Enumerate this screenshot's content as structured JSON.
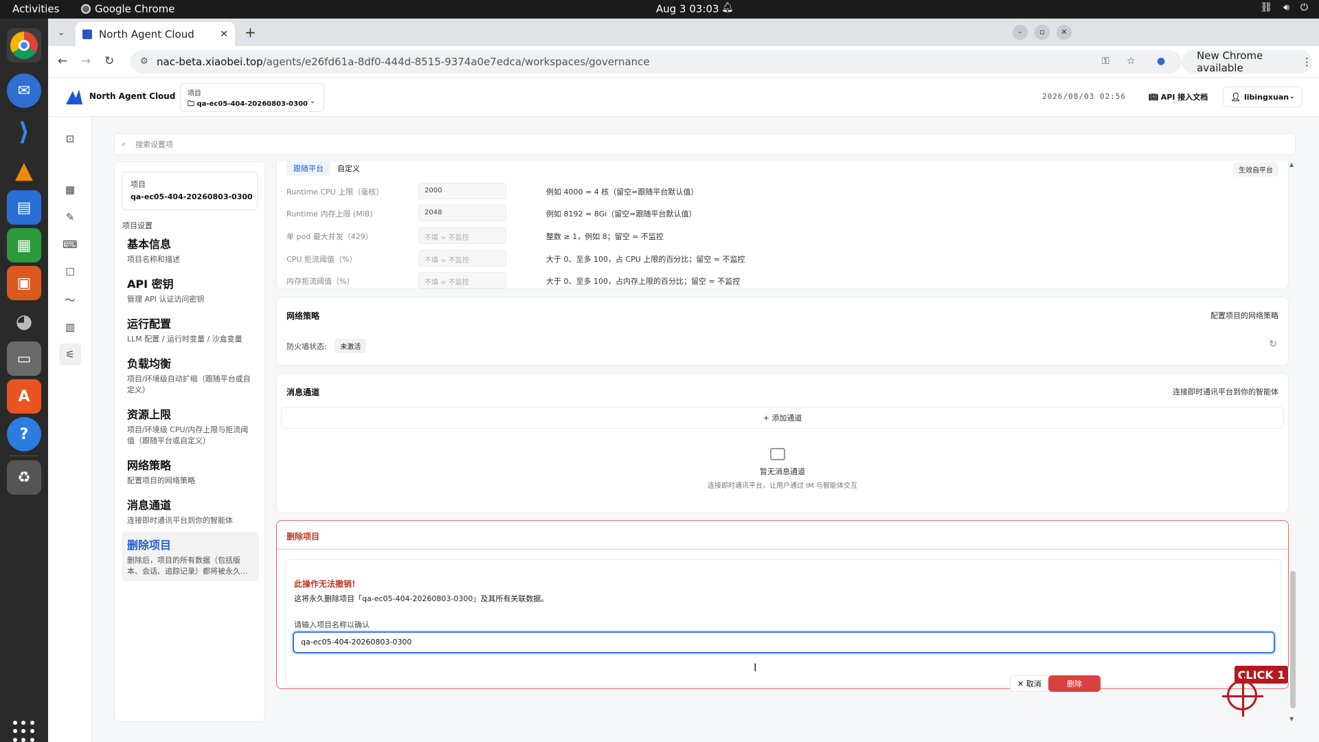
{
  "system": {
    "activities": "Activities",
    "app_name": "Google Chrome",
    "clock": "Aug 3  03:03"
  },
  "browser": {
    "tab_title": "North Agent Cloud",
    "url_host": "nac-beta.xiaobei.top",
    "url_path": "/agents/e26fd61a-8df0-444d-8515-9374a0e7edca/workspaces/governance",
    "new_chrome": "New Chrome available"
  },
  "header": {
    "brand": "North Agent Cloud",
    "project_label": "项目",
    "project_value": "qa-ec05-404-20260803-0300",
    "timestamp": "2026/08/03 02:56",
    "api_docs": "API 接入文档",
    "user": "libingxuan"
  },
  "search": {
    "placeholder": "搜索设置项"
  },
  "settings_nav": {
    "project_label": "项目",
    "project_value": "qa-ec05-404-20260803-0300",
    "heading": "项目设置",
    "items": [
      {
        "title": "基本信息",
        "desc": "项目名称和描述"
      },
      {
        "title": "API 密钥",
        "desc": "管理 API 认证访问密钥"
      },
      {
        "title": "运行配置",
        "desc": "LLM 配置 / 运行时变量 / 沙盒变量"
      },
      {
        "title": "负载均衡",
        "desc": "项目/环境级自动扩缩（跟随平台或自定义）"
      },
      {
        "title": "资源上限",
        "desc": "项目/环境级 CPU/内存上限与拒流阈值（跟随平台或自定义）"
      },
      {
        "title": "网络策略",
        "desc": "配置项目的网络策略"
      },
      {
        "title": "消息通道",
        "desc": "连接即时通讯平台到你的智能体"
      },
      {
        "title": "删除项目",
        "desc": "删除后，项目的所有数据（包括版本、会话、追踪记录）都将被永久..."
      }
    ]
  },
  "resource_limits": {
    "seg_follow": "跟随平台",
    "seg_custom": "自定义",
    "scope_tag": "生效自平台",
    "rows": [
      {
        "label": "Runtime CPU 上限（毫核）",
        "value": "2000",
        "hint": "例如 4000 = 4 核（留空=跟随平台默认值）"
      },
      {
        "label": "Runtime 内存上限 (MiB)",
        "value": "2048",
        "hint": "例如 8192 = 8Gi（留空=跟随平台默认值）"
      },
      {
        "label": "单 pod 最大并发（429）",
        "value": "不填 = 不监控",
        "hint": "整数 ≥ 1，例如 8；留空 = 不监控"
      },
      {
        "label": "CPU 拒流阈值（%）",
        "value": "不填 = 不监控",
        "hint": "大于 0、至多 100，占 CPU 上限的百分比；留空 = 不监控"
      },
      {
        "label": "内存拒流阈值（%）",
        "value": "不填 = 不监控",
        "hint": "大于 0、至多 100，占内存上限的百分比；留空 = 不监控"
      }
    ]
  },
  "network": {
    "title": "网络策略",
    "right": "配置项目的网络策略",
    "firewall_label": "防火墙状态:",
    "firewall_status": "未激活"
  },
  "channels": {
    "title": "消息通道",
    "right": "连接即时通讯平台到你的智能体",
    "add": "+ 添加通道",
    "empty_title": "暂无消息通道",
    "empty_desc": "连接即时通讯平台，让用户通过 IM 与智能体交互"
  },
  "delete": {
    "title": "删除项目",
    "warning": "此操作无法撤销!",
    "desc": "这将永久删除项目「qa-ec05-404-20260803-0300」及其所有关联数据。",
    "confirm_label": "请输入项目名称以确认",
    "confirm_value": "qa-ec05-404-20260803-0300",
    "cancel": "✕ 取消",
    "delete_btn": "删除"
  },
  "overlay": {
    "click_label": "CLICK 1"
  }
}
